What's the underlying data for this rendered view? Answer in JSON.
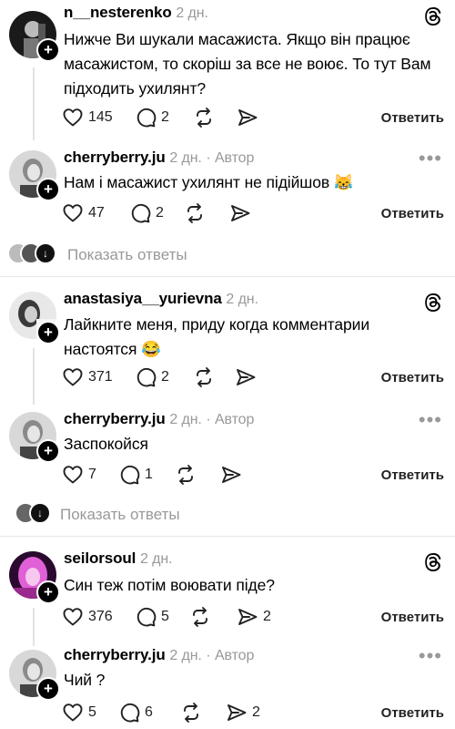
{
  "posts": [
    {
      "user": "n__nesterenko",
      "time": "2 дн.",
      "author": "",
      "text": "Нижче Ви шукали масажиста. Якщо він працює масажистом, то скоріш за все не воює. То тут Вам підходить ухилянт?",
      "likes": "145",
      "comments": "2",
      "reposts": "",
      "shares": "",
      "reply": "Ответить"
    },
    {
      "user": "cherryberry.ju",
      "time": "2 дн.",
      "author": "· Автор",
      "text": "Нам і масажист ухилянт не підійшов 😹",
      "likes": "47",
      "comments": "2",
      "reposts": "",
      "shares": "",
      "reply": "Ответить"
    },
    {
      "user": "anastasiya__yurievna",
      "time": "2 дн.",
      "author": "",
      "text": "Лайкните меня, приду когда комментарии настоятся 😂",
      "likes": "371",
      "comments": "2",
      "reposts": "",
      "shares": "",
      "reply": "Ответить"
    },
    {
      "user": "cherryberry.ju",
      "time": "2 дн.",
      "author": "· Автор",
      "text": "Заспокойся",
      "likes": "7",
      "comments": "1",
      "reposts": "",
      "shares": "",
      "reply": "Ответить"
    },
    {
      "user": "seilorsoul",
      "time": "2 дн.",
      "author": "",
      "text": "Син теж потім воювати піде?",
      "likes": "376",
      "comments": "5",
      "reposts": "",
      "shares": "2",
      "reply": "Ответить"
    },
    {
      "user": "cherryberry.ju",
      "time": "2 дн.",
      "author": "· Автор",
      "text": "Чий ?",
      "likes": "5",
      "comments": "6",
      "reposts": "",
      "shares": "2",
      "reply": "Ответить"
    }
  ],
  "show_replies": "Показать ответы",
  "icons": {
    "like": "heart-icon",
    "comment": "comment-bubble-icon",
    "repost": "repost-icon",
    "share": "send-icon",
    "threads": "threads-logo-icon",
    "more": "more-dots-icon",
    "follow": "plus-icon"
  },
  "colors": {
    "meta": "#999999",
    "text": "#000000",
    "divider": "#e6e6e6",
    "follow_badge": "#000000"
  }
}
